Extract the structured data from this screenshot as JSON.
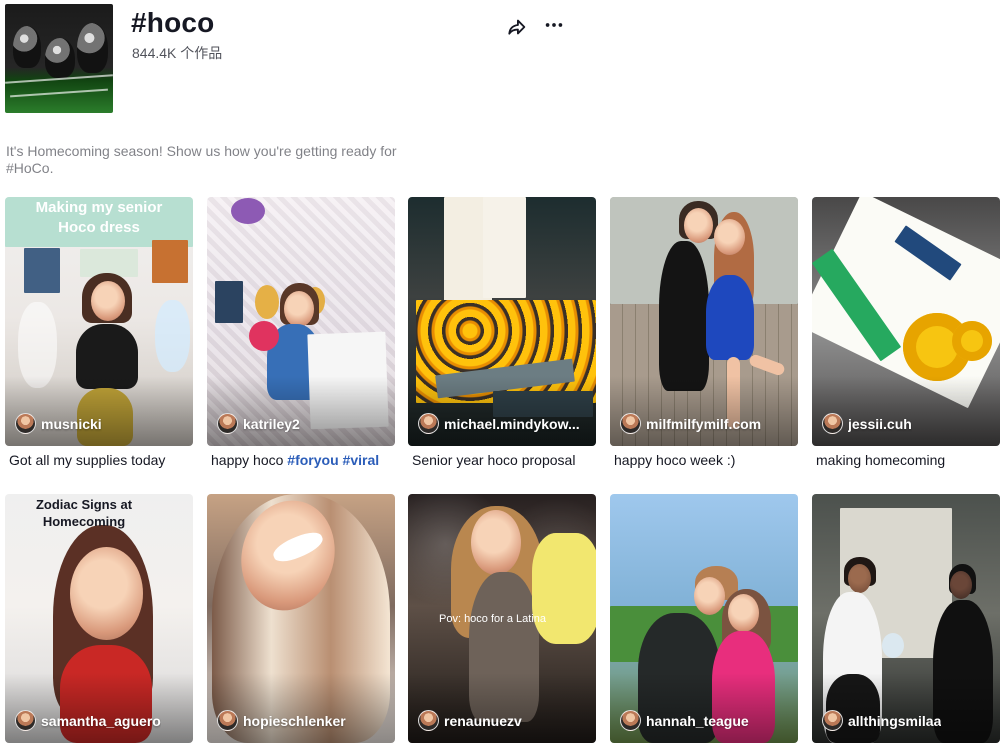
{
  "page": {
    "title": "#hoco",
    "views": "844.4K 个作品",
    "description": "It's Homecoming season! Show us how you're getting ready for #HoCo."
  },
  "icons": {
    "share": "share-icon",
    "more": "more-icon"
  },
  "videos": [
    {
      "author": "musnicki",
      "caption": "Got all my supplies today",
      "overlay": "Making my senior\nHoco dress"
    },
    {
      "author": "katriley2",
      "caption_prefix": "happy hoco ",
      "tags": [
        "#foryou",
        "#viral"
      ]
    },
    {
      "author": "michael.mindykow...",
      "caption": "Senior year hoco proposal"
    },
    {
      "author": "milfmilfymilf.com",
      "caption": "happy hoco week :)"
    },
    {
      "author": "jessii.cuh",
      "caption": "making homecoming"
    },
    {
      "author": "samantha_aguero",
      "overlay": "Zodiac Signs at\nHomecoming"
    },
    {
      "author": "hopieschlenker"
    },
    {
      "author": "renaunuezv",
      "overlay": "Pov: hoco for a Latina"
    },
    {
      "author": "hannah_teague"
    },
    {
      "author": "allthingsmilaa"
    }
  ]
}
